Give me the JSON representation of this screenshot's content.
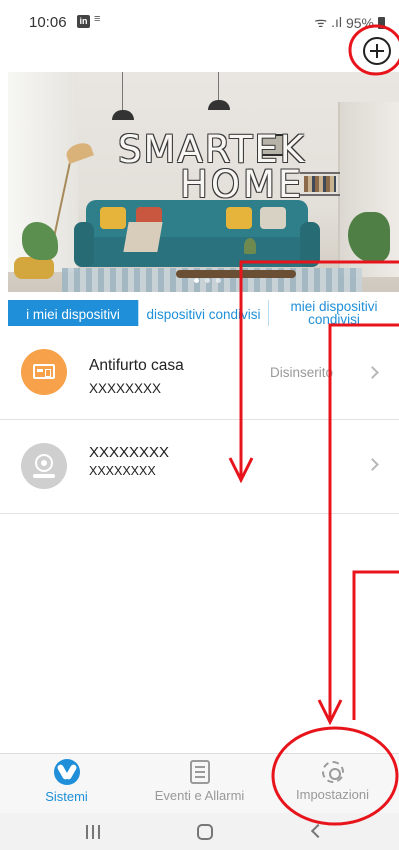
{
  "status_bar": {
    "time": "10:06",
    "linkedin_badge": "in",
    "notification_glyph": "≡",
    "network": "ᯤ .ıl",
    "battery": "95%"
  },
  "header": {
    "add_icon": "plus-circle-icon"
  },
  "banner": {
    "logo_line1": "SMARTEK",
    "logo_line2": "HOME",
    "slides": 3,
    "active_slide": 1
  },
  "tabs": [
    {
      "label": "i miei dispositivi",
      "active": true
    },
    {
      "label": "dispositivi condivisi",
      "active": false
    },
    {
      "label": "miei dispositivi condivisi",
      "active": false
    }
  ],
  "devices": [
    {
      "name": "Antifurto casa",
      "id": "XXXXXXXX",
      "status": "Disinserito",
      "icon": "alarm-panel-icon",
      "icon_color": "#f7a14a"
    },
    {
      "name": "XXXXXXXX",
      "id": "XXXXXXXX",
      "status": "",
      "icon": "camera-icon",
      "icon_color": "#cfcfcf"
    }
  ],
  "bottom_nav": [
    {
      "label": "Sistemi",
      "icon": "sistemi-icon",
      "active": true
    },
    {
      "label": "Eventi e Allarmi",
      "icon": "events-icon",
      "active": false
    },
    {
      "label": "Impostazioni",
      "icon": "gear-icon",
      "active": false
    }
  ],
  "colors": {
    "accent": "#1e8fd8",
    "annotation": "#e8141b",
    "alarm_icon": "#f7a14a",
    "inactive_text": "#999999"
  }
}
